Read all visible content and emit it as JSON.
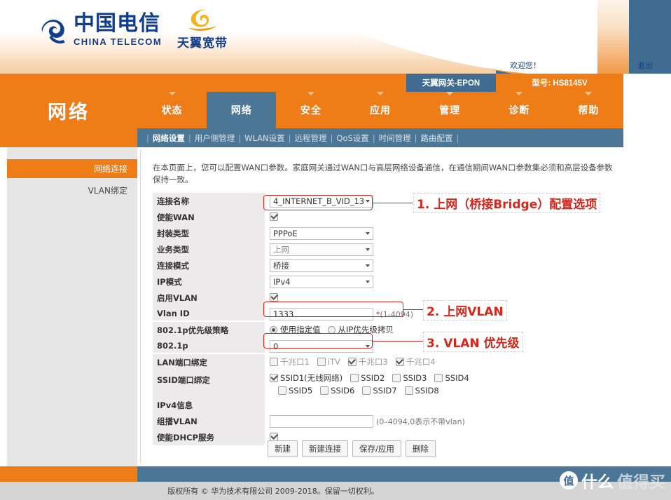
{
  "header": {
    "brand_cn": "中国电信",
    "brand_en": "CHINA TELECOM",
    "sub_brand_cn": "天翼宽带",
    "welcome": "欢迎您！",
    "logout": "退出",
    "device_name": "天翼网关-EPON",
    "model": "型号: HS8145V"
  },
  "nav": {
    "section_title": "网络",
    "tabs": [
      {
        "label": "状态",
        "active": false
      },
      {
        "label": "网络",
        "active": true
      },
      {
        "label": "安全",
        "active": false
      },
      {
        "label": "应用",
        "active": false
      },
      {
        "label": "管理",
        "active": false
      },
      {
        "label": "诊断",
        "active": false
      },
      {
        "label": "帮助",
        "active": false
      }
    ],
    "subnav": [
      {
        "label": "网络设置",
        "active": true
      },
      {
        "label": "用户侧管理",
        "active": false
      },
      {
        "label": "WLAN设置",
        "active": false
      },
      {
        "label": "远程管理",
        "active": false
      },
      {
        "label": "QoS设置",
        "active": false
      },
      {
        "label": "时间管理",
        "active": false
      },
      {
        "label": "路由配置",
        "active": false
      }
    ]
  },
  "sidebar": {
    "items": [
      {
        "label": "网络连接",
        "selected": true
      },
      {
        "label": "VLAN绑定",
        "selected": false
      }
    ]
  },
  "main": {
    "description": "在本页面上，您可以配置WAN口参数。家庭网关通过WAN口与高层网络设备通信，在通信期间WAN口参数集必须和高层设备参数保持一致。",
    "fields": {
      "conn_name_label": "连接名称",
      "conn_name_value": "4_INTERNET_B_VID_13",
      "enable_wan_label": "使能WAN",
      "encap_label": "封装类型",
      "encap_value": "PPPoE",
      "service_label": "业务类型",
      "service_value": "上网",
      "mode_label": "连接模式",
      "mode_value": "桥接",
      "ipmode_label": "IP模式",
      "ipmode_value": "IPv4",
      "enable_vlan_label": "启用VLAN",
      "vlanid_label": "Vlan ID",
      "vlanid_value": "1333",
      "vlanid_hint_star": "*",
      "vlanid_hint": "(1-4094)",
      "p8021p_policy_label": "802.1p优先级策略",
      "p8021p_policy_opt1": "使用指定值",
      "p8021p_policy_opt2": "从IP优先级拷贝",
      "p8021p_label": "802.1p",
      "p8021p_value": "0",
      "lan_bind_label": "LAN端口绑定",
      "ssid_bind_label": "SSID端口绑定",
      "ipv4_info_label": "IPv4信息",
      "mcast_vlan_label": "组播VLAN",
      "mcast_vlan_value": "",
      "mcast_vlan_hint": "(0–4094,0表示不带vlan)",
      "dhcp_label": "使能DHCP服务"
    },
    "checkboxes": {
      "enable_wan": true,
      "enable_vlan": true,
      "enable_dhcp": true
    },
    "lan_ports": [
      {
        "label": "千兆口1",
        "checked": false
      },
      {
        "label": "iTV",
        "checked": false
      },
      {
        "label": "千兆口3",
        "checked": true
      },
      {
        "label": "千兆口4",
        "checked": true
      }
    ],
    "ssid_ports_row1": [
      {
        "label": "SSID1(无线网络)",
        "checked": true
      },
      {
        "label": "SSID2",
        "checked": false
      },
      {
        "label": "SSID3",
        "checked": false
      },
      {
        "label": "SSID4",
        "checked": false
      }
    ],
    "ssid_ports_row2": [
      {
        "label": "SSID5",
        "checked": false
      },
      {
        "label": "SSID6",
        "checked": false
      },
      {
        "label": "SSID7",
        "checked": false
      },
      {
        "label": "SSID8",
        "checked": false
      }
    ],
    "buttons": [
      {
        "label": "新建"
      },
      {
        "label": "新建连接"
      },
      {
        "label": "保存/应用"
      },
      {
        "label": "删除"
      }
    ]
  },
  "annotations": [
    {
      "text": "1. 上网（桥接Bridge）配置选项"
    },
    {
      "text": "2. 上网VLAN"
    },
    {
      "text": "3. VLAN 优先级"
    }
  ],
  "footer": {
    "copyright": "版权所有 © 华为技术有限公司 2009-2018。保留一切权利。",
    "watermark_badge": "值",
    "watermark_text1": "什么",
    "watermark_text2": "值得买"
  },
  "colors": {
    "orange": "#ee7d18",
    "steel_blue": "#4c7695",
    "brand_blue": "#123e8c",
    "annotation_red": "#d9261c"
  }
}
